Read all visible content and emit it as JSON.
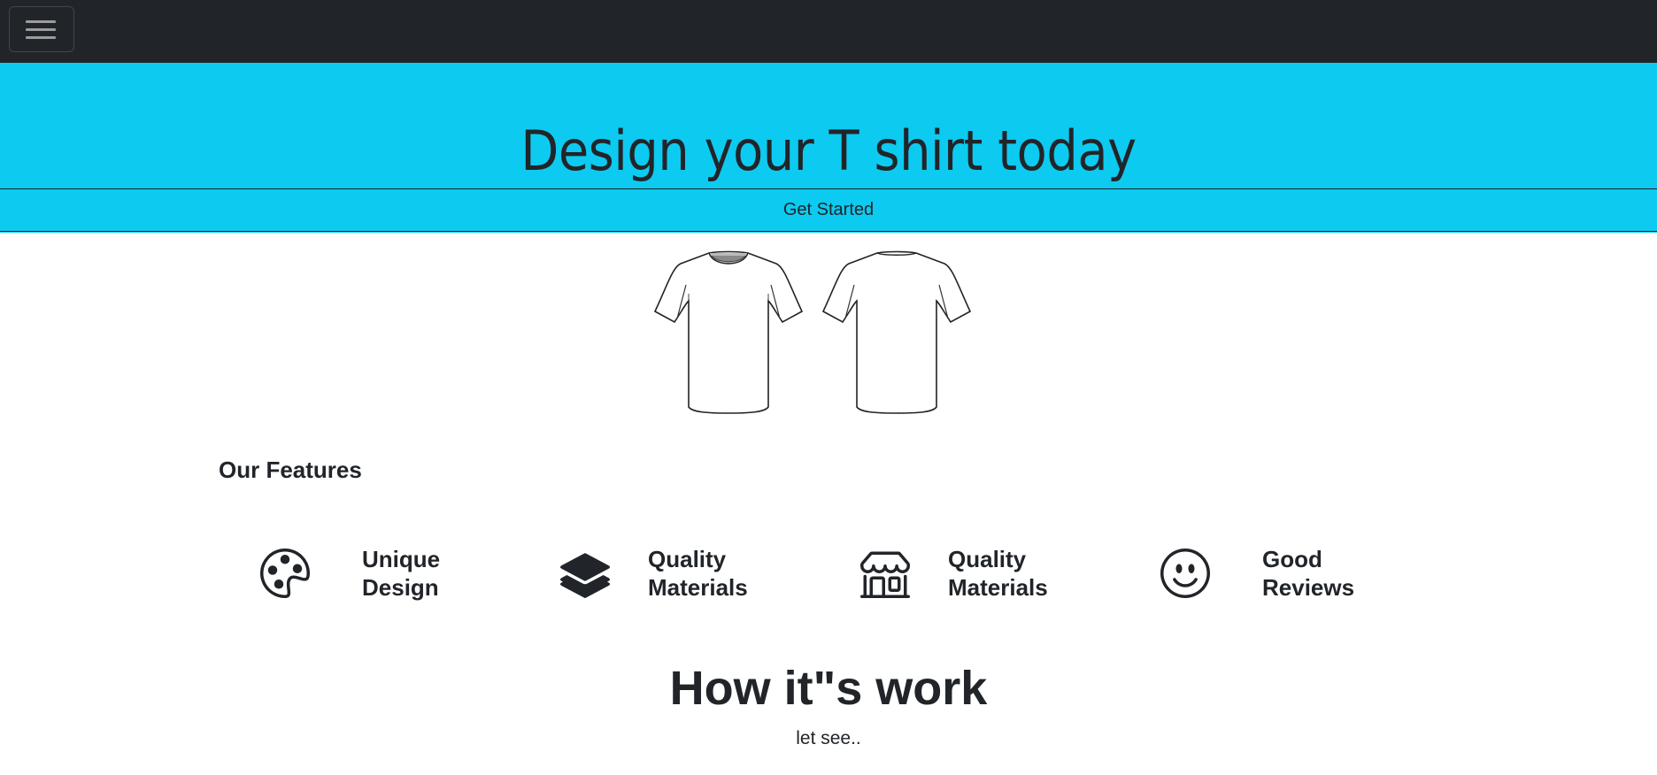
{
  "navbar": {
    "toggler_icon": "hamburger-menu-icon"
  },
  "hero": {
    "title": "Design your T shirt today",
    "button_label": "Get Started",
    "background_color": "#0dcaf0"
  },
  "shirts": {
    "front_icon": "tshirt-front-image",
    "back_icon": "tshirt-back-image"
  },
  "features": {
    "heading": "Our Features",
    "items": [
      {
        "icon": "palette-icon",
        "line1": "Unique",
        "line2": "Design"
      },
      {
        "icon": "layers-icon",
        "line1": "Quality",
        "line2": "Materials"
      },
      {
        "icon": "shop-icon",
        "line1": "Quality",
        "line2": "Materials"
      },
      {
        "icon": "smiley-icon",
        "line1": "Good",
        "line2": "Reviews"
      }
    ]
  },
  "how": {
    "title": "How it\"s work",
    "subtitle": "let see.."
  }
}
